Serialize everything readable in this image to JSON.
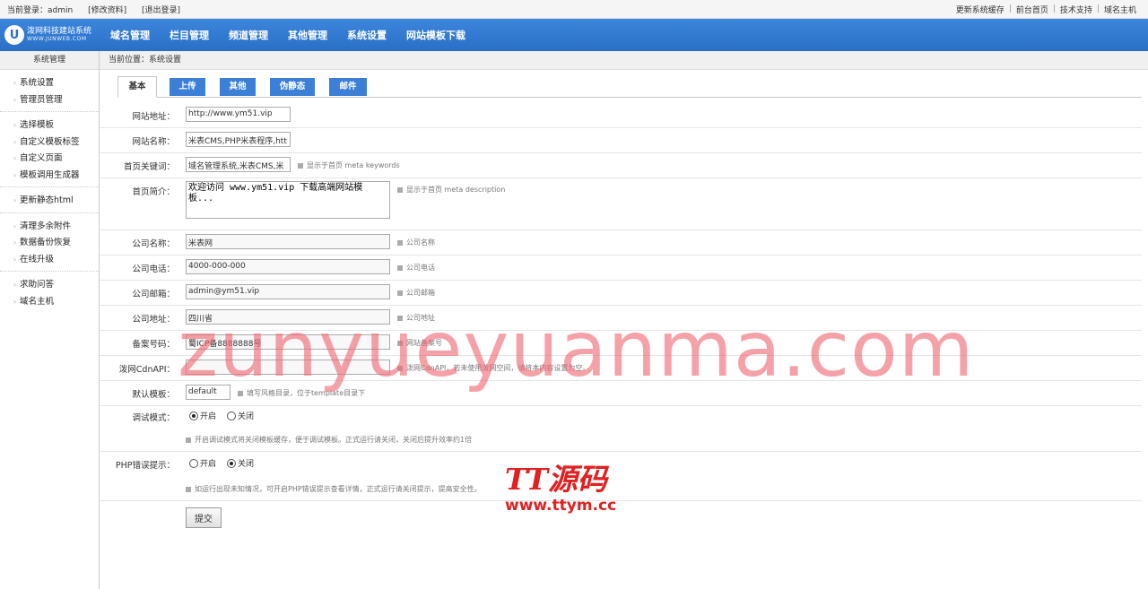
{
  "topbar": {
    "login_prefix": "当前登录：admin",
    "edit_profile": "[修改资料]",
    "logout": "[退出登录]",
    "links": [
      "更新系统缓存",
      "前台首页",
      "技术支持",
      "域名主机"
    ],
    "separator": "|"
  },
  "logo": {
    "icon_letter": "U",
    "name": "泼网科技建站系统",
    "sub": "WWW.JUNWEB.COM"
  },
  "nav": [
    "域名管理",
    "栏目管理",
    "频道管理",
    "其他管理",
    "系统设置",
    "网站模板下载"
  ],
  "sidebar": {
    "title": "系统管理",
    "groups": [
      [
        "系统设置",
        "管理员管理"
      ],
      [
        "选择模板",
        "自定义模板标签",
        "自定义页面",
        "模板调用生成器"
      ],
      [
        "更新静态html"
      ],
      [
        "清理多余附件",
        "数据备份恢复",
        "在线升级"
      ],
      [
        "求助问答",
        "域名主机"
      ]
    ]
  },
  "breadcrumb": "当前位置：系统设置",
  "tabs": [
    "基本",
    "上传",
    "其他",
    "伪静态",
    "邮件"
  ],
  "form": {
    "site_url": {
      "label": "网站地址：",
      "value": "http://www.ym51.vip"
    },
    "site_name": {
      "label": "网站名称：",
      "value": "米表CMS,PHP米表程序,htt"
    },
    "keywords": {
      "label": "首页关键词：",
      "value": "域名管理系统,米表CMS,米",
      "hint": "显示于首页 meta keywords"
    },
    "description": {
      "label": "首页简介：",
      "value": "欢迎访问 www.ym51.vip 下载高端网站模板...",
      "hint": "显示于首页 meta description"
    },
    "company_name": {
      "label": "公司名称：",
      "value": "米表网",
      "hint": "公司名称"
    },
    "company_phone": {
      "label": "公司电话：",
      "value": "4000-000-000",
      "hint": "公司电话"
    },
    "company_email": {
      "label": "公司邮箱：",
      "value": "admin@ym51.vip",
      "hint": "公司邮箱"
    },
    "company_address": {
      "label": "公司地址：",
      "value": "四川省",
      "hint": "公司地址"
    },
    "icp": {
      "label": "备案号码：",
      "value": "蜀ICP备8888888号",
      "hint": "网站备案号"
    },
    "cdn_api": {
      "label": "泼网CdnAPI：",
      "value": "",
      "hint": "泼网CdnAPI，若未使用泼网空间，请将本内容设置为空。"
    },
    "template": {
      "label": "默认模板：",
      "value": "default",
      "hint": "填写风格目录，位于template目录下"
    },
    "debug": {
      "label": "调试模式：",
      "on": "开启",
      "off": "关闭",
      "selected": "on",
      "hint": "开启调试模式将关闭模板缓存，便于调试模板。正式运行请关闭，关闭后提升效率约1倍"
    },
    "php_errors": {
      "label": "PHP错误提示：",
      "on": "开启",
      "off": "关闭",
      "selected": "off",
      "hint": "如运行出现未知情况，可开启PHP错误提示查看详情，正式运行请关闭提示，提高安全性。"
    },
    "submit": "提交"
  },
  "watermark": {
    "big": "zunyueyuanma.com",
    "logo": "TT源码",
    "url": "www.ttym.cc"
  }
}
